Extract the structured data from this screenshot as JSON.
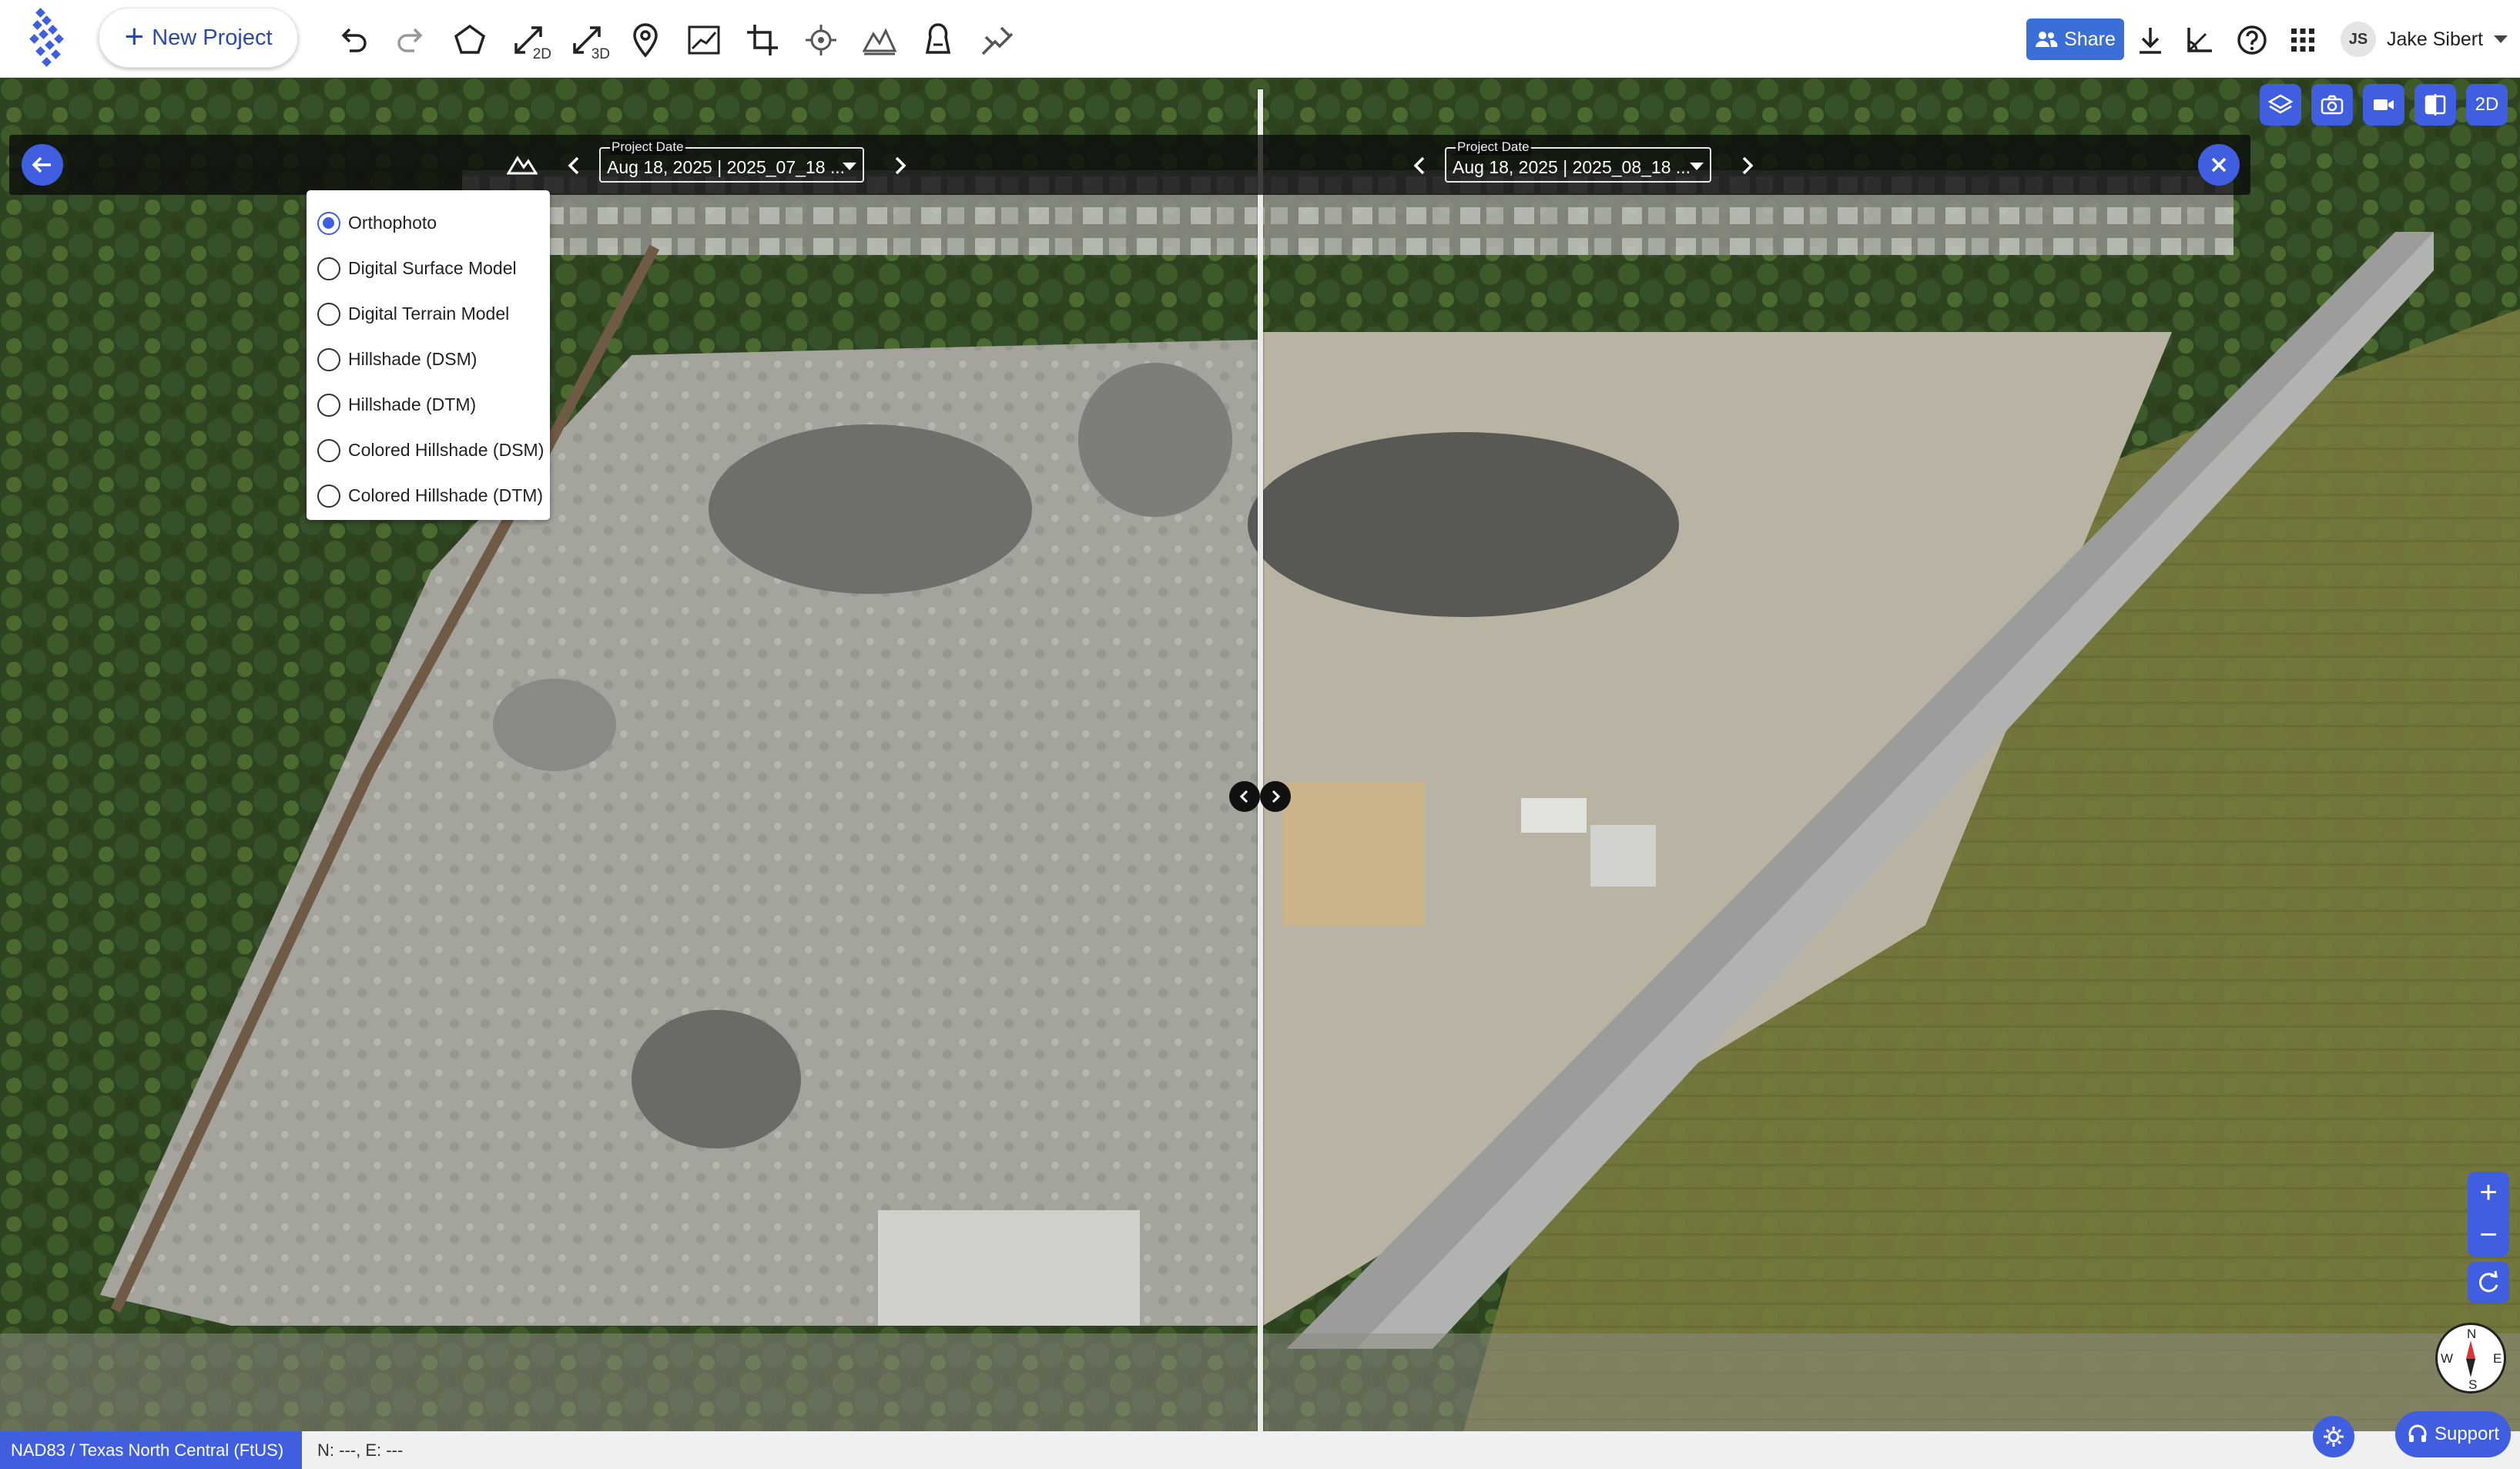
{
  "toolbar": {
    "new_project_label": "New Project",
    "tools": [
      {
        "icon": "undo-icon"
      },
      {
        "icon": "redo-icon"
      },
      {
        "icon": "polygon-icon"
      },
      {
        "icon": "measure-2d-icon",
        "sub": "2D"
      },
      {
        "icon": "measure-3d-icon",
        "sub": "3D"
      },
      {
        "icon": "location-pin-icon"
      },
      {
        "icon": "profile-chart-icon"
      },
      {
        "icon": "crop-icon"
      },
      {
        "icon": "target-icon"
      },
      {
        "icon": "terrain-icon"
      },
      {
        "icon": "volume-icon"
      },
      {
        "icon": "annotation-icon"
      }
    ],
    "share_label": "Share",
    "user_initials": "JS",
    "user_name": "Jake Sibert"
  },
  "compare": {
    "left": {
      "date_label": "Project Date",
      "date_value": "Aug 18, 2025 | 2025_07_18 ..."
    },
    "right": {
      "date_label": "Project Date",
      "date_value": "Aug 18, 2025 | 2025_08_18 ..."
    }
  },
  "layers": {
    "selected": "Orthophoto",
    "options": [
      "Orthophoto",
      "Digital Surface Model",
      "Digital Terrain Model",
      "Hillshade (DSM)",
      "Hillshade (DTM)",
      "Colored Hillshade (DSM)",
      "Colored Hillshade (DTM)"
    ]
  },
  "map_controls": {
    "view_mode": "2D",
    "zoom_in": "+",
    "zoom_out": "−",
    "compass": {
      "n": "N",
      "s": "S",
      "e": "E",
      "w": "W"
    }
  },
  "status": {
    "crs": "NAD83 / Texas North Central (FtUS)",
    "coordinates": "N: ---, E: ---"
  },
  "support_label": "Support",
  "colors": {
    "accent": "#3f5fe0",
    "share": "#3b6fd8"
  }
}
